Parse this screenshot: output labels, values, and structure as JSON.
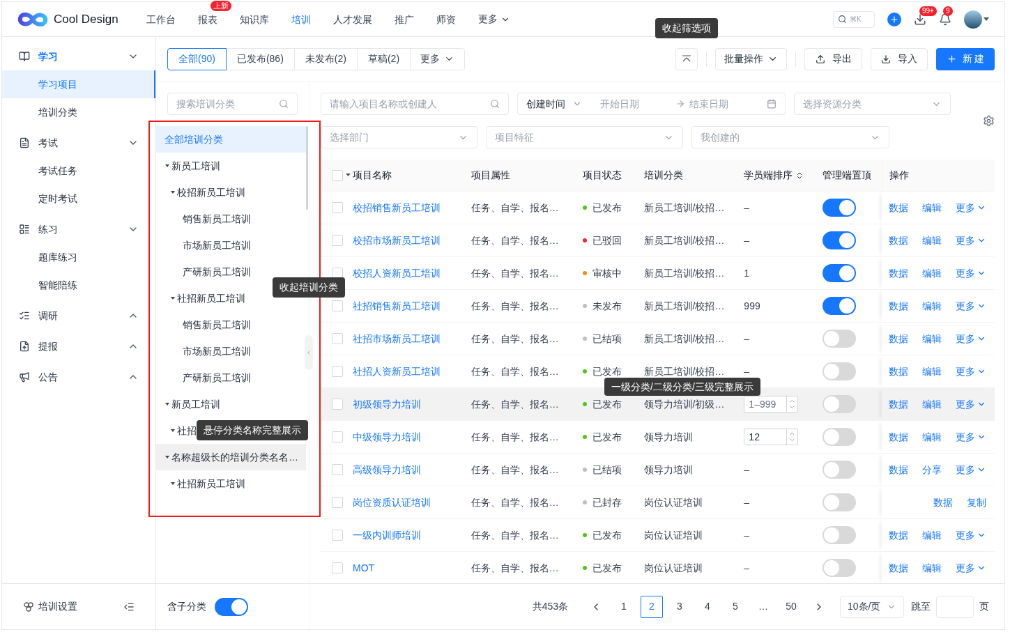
{
  "nav": {
    "logo": "Cool Design",
    "items": [
      {
        "label": "工作台",
        "selected": false
      },
      {
        "label": "报表",
        "selected": false,
        "badge": "上新"
      },
      {
        "label": "知识库",
        "selected": false
      },
      {
        "label": "培训",
        "selected": true
      },
      {
        "label": "人才发展",
        "selected": false
      },
      {
        "label": "推广",
        "selected": false
      },
      {
        "label": "师资",
        "selected": false
      }
    ],
    "more": "更多",
    "search_hint": "⌘K",
    "download_badge": "99+",
    "bell_badge": "9"
  },
  "sidebar": {
    "groups": [
      {
        "label": "学习",
        "kind": "book",
        "expanded": true,
        "selected": true,
        "children": [
          {
            "label": "学习项目",
            "selected": true
          },
          {
            "label": "培训分类",
            "selected": false
          }
        ]
      },
      {
        "label": "考试",
        "kind": "exam",
        "expanded": true,
        "selected": false,
        "children": [
          {
            "label": "考试任务",
            "selected": false
          },
          {
            "label": "定时考试",
            "selected": false
          }
        ]
      },
      {
        "label": "练习",
        "kind": "practice",
        "expanded": true,
        "selected": false,
        "children": [
          {
            "label": "题库练习",
            "selected": false
          },
          {
            "label": "智能陪练",
            "selected": false
          }
        ]
      },
      {
        "label": "调研",
        "kind": "survey",
        "expanded": false,
        "selected": false
      },
      {
        "label": "提报",
        "kind": "report",
        "expanded": false,
        "selected": false
      },
      {
        "label": "公告",
        "kind": "notice",
        "expanded": false,
        "selected": false
      }
    ],
    "footer": "培训设置"
  },
  "toolbar": {
    "tabs": [
      {
        "label": "全部(90)",
        "selected": true
      },
      {
        "label": "已发布(86)",
        "selected": false
      },
      {
        "label": "未发布(2)",
        "selected": false
      },
      {
        "label": "草稿(2)",
        "selected": false
      }
    ],
    "more": "更多",
    "collapse_tooltip": "收起筛选项",
    "batch": "批量操作",
    "export": "导出",
    "import": "导入",
    "create": "新 建"
  },
  "tree": {
    "search_placeholder": "搜索培训分类",
    "collapse_tooltip": "收起培训分类",
    "include_children": {
      "label": "含子分类",
      "on": true
    },
    "items": [
      {
        "label": "全部培训分类",
        "selected": true,
        "hovered": false
      },
      {
        "label": "新员工培训",
        "selected": false,
        "hovered": false,
        "expanded": true,
        "children": [
          {
            "label": "校招新员工培训",
            "selected": false,
            "hovered": false,
            "expanded": true,
            "children": [
              {
                "label": "销售新员工培训",
                "selected": false,
                "hovered": false
              },
              {
                "label": "市场新员工培训",
                "selected": false,
                "hovered": false
              },
              {
                "label": "产研新员工培训",
                "selected": false,
                "hovered": false
              }
            ]
          },
          {
            "label": "社招新员工培训",
            "selected": false,
            "hovered": false,
            "expanded": true,
            "children": [
              {
                "label": "销售新员工培训",
                "selected": false,
                "hovered": false
              },
              {
                "label": "市场新员工培训",
                "selected": false,
                "hovered": false
              },
              {
                "label": "产研新员工培训",
                "selected": false,
                "hovered": false
              }
            ]
          }
        ]
      },
      {
        "label": "新员工培训",
        "selected": false,
        "hovered": false,
        "expanded": true,
        "children": [
          {
            "label": "社招",
            "selected": false,
            "hovered": false,
            "expanded": true,
            "tooltip": "悬停分类名称完整展示"
          }
        ]
      },
      {
        "label": "名称超级长的培训分类名名…",
        "selected": false,
        "hovered": true,
        "expanded": true,
        "children": [
          {
            "label": "社招新员工培训",
            "selected": false,
            "hovered": false,
            "expanded": true
          }
        ]
      }
    ]
  },
  "filters": {
    "search_placeholder": "请输入项目名称或创建人",
    "date_type": "创建时间",
    "start_placeholder": "开始日期",
    "end_placeholder": "结束日期",
    "resource_placeholder": "选择资源分类",
    "department_placeholder": "选择部门",
    "feature_placeholder": "项目特征",
    "creator": "我创建的"
  },
  "table": {
    "header_checked": false,
    "columns": [
      "项目名称",
      "项目属性",
      "项目状态",
      "培训分类",
      "学员端排序",
      "管理端置顶",
      "操作"
    ],
    "rows": [
      {
        "name": "校招销售新员工培训",
        "checked": false,
        "attr": "任务、自学、报名…",
        "status": {
          "label": "已发布",
          "color": "#52c41a"
        },
        "category": "新员工培训/校招…",
        "sort": {
          "kind": "text",
          "value": "–"
        },
        "pinned": true,
        "hovered": false,
        "actions": [
          {
            "label": "数据",
            "kind": "link"
          },
          {
            "label": "编辑",
            "kind": "link"
          },
          {
            "label": "更多",
            "kind": "menu"
          }
        ]
      },
      {
        "name": "校招市场新员工培训",
        "checked": false,
        "attr": "任务、自学、报名…",
        "status": {
          "label": "已驳回",
          "color": "#f5222d"
        },
        "category": "新员工培训/校招…",
        "sort": {
          "kind": "text",
          "value": "–"
        },
        "pinned": true,
        "hovered": false,
        "actions": [
          {
            "label": "数据",
            "kind": "link"
          },
          {
            "label": "编辑",
            "kind": "link"
          },
          {
            "label": "更多",
            "kind": "menu"
          }
        ]
      },
      {
        "name": "校招人资新员工培训",
        "checked": false,
        "attr": "任务、自学、报名…",
        "status": {
          "label": "审核中",
          "color": "#fa8c16"
        },
        "category": "新员工培训/校招…",
        "sort": {
          "kind": "text",
          "value": "1"
        },
        "pinned": true,
        "hovered": false,
        "actions": [
          {
            "label": "数据",
            "kind": "link"
          },
          {
            "label": "编辑",
            "kind": "link"
          },
          {
            "label": "更多",
            "kind": "menu"
          }
        ]
      },
      {
        "name": "社招销售新员工培训",
        "checked": false,
        "attr": "任务、自学、报名…",
        "status": {
          "label": "未发布",
          "color": "#bfbfbf"
        },
        "category": "新员工培训/校招…",
        "sort": {
          "kind": "text",
          "value": "999"
        },
        "pinned": true,
        "hovered": false,
        "actions": [
          {
            "label": "数据",
            "kind": "link"
          },
          {
            "label": "编辑",
            "kind": "link"
          },
          {
            "label": "更多",
            "kind": "menu"
          }
        ]
      },
      {
        "name": "社招市场新员工培训",
        "checked": false,
        "attr": "任务、自学、报名…",
        "status": {
          "label": "已结项",
          "color": "#bfbfbf"
        },
        "category": "新员工培训/校招…",
        "sort": {
          "kind": "text",
          "value": "–"
        },
        "pinned": false,
        "hovered": false,
        "actions": [
          {
            "label": "数据",
            "kind": "link"
          },
          {
            "label": "编辑",
            "kind": "link"
          },
          {
            "label": "更多",
            "kind": "menu"
          }
        ]
      },
      {
        "name": "社招人资新员工培训",
        "checked": false,
        "attr": "任务、自学、报名…",
        "status": {
          "label": "已发布",
          "color": "#52c41a"
        },
        "category": "新员工培训/校招…",
        "sort": {
          "kind": "text",
          "value": "–"
        },
        "pinned": false,
        "hovered": false,
        "actions": [
          {
            "label": "数据",
            "kind": "link"
          },
          {
            "label": "编辑",
            "kind": "link"
          },
          {
            "label": "更多",
            "kind": "menu"
          }
        ]
      },
      {
        "name": "初级领导力培训",
        "checked": false,
        "attr": "任务、自学、报名…",
        "status": {
          "label": "已发布",
          "color": "#52c41a"
        },
        "category": "领导力培训/初级…",
        "tooltip": "一级分类/二级分类/三级完整展示",
        "sort": {
          "kind": "input",
          "placeholder": "1–999"
        },
        "pinned": false,
        "hovered": true,
        "actions": [
          {
            "label": "数据",
            "kind": "link"
          },
          {
            "label": "编辑",
            "kind": "link"
          },
          {
            "label": "更多",
            "kind": "menu"
          }
        ]
      },
      {
        "name": "中级领导力培训",
        "checked": false,
        "attr": "任务、自学、报名…",
        "status": {
          "label": "已发布",
          "color": "#52c41a"
        },
        "category": "领导力培训",
        "sort": {
          "kind": "input",
          "value": "12"
        },
        "pinned": false,
        "hovered": false,
        "actions": [
          {
            "label": "数据",
            "kind": "link"
          },
          {
            "label": "编辑",
            "kind": "link"
          },
          {
            "label": "更多",
            "kind": "menu"
          }
        ]
      },
      {
        "name": "高级领导力培训",
        "checked": false,
        "attr": "任务、自学、报名…",
        "status": {
          "label": "已结项",
          "color": "#bfbfbf"
        },
        "category": "领导力培训",
        "sort": {
          "kind": "text",
          "value": "–"
        },
        "pinned": false,
        "hovered": false,
        "actions": [
          {
            "label": "数据",
            "kind": "link"
          },
          {
            "label": "分享",
            "kind": "link"
          },
          {
            "label": "更多",
            "kind": "menu"
          }
        ]
      },
      {
        "name": "岗位资质认证培训",
        "checked": false,
        "attr": "任务、自学、报名…",
        "status": {
          "label": "已封存",
          "color": "#bfbfbf"
        },
        "category": "岗位认证培训",
        "sort": {
          "kind": "text",
          "value": "–"
        },
        "pinned": false,
        "hovered": false,
        "actions": [
          {
            "label": "数据",
            "kind": "link"
          },
          {
            "label": "复制",
            "kind": "link"
          }
        ]
      },
      {
        "name": "一级内训师培训",
        "checked": false,
        "attr": "任务、自学、报名…",
        "status": {
          "label": "已发布",
          "color": "#52c41a"
        },
        "category": "岗位认证培训",
        "sort": {
          "kind": "text",
          "value": "–"
        },
        "pinned": false,
        "hovered": false,
        "actions": [
          {
            "label": "数据",
            "kind": "link"
          },
          {
            "label": "编辑",
            "kind": "link"
          },
          {
            "label": "更多",
            "kind": "menu"
          }
        ]
      },
      {
        "name": "MOT",
        "checked": false,
        "attr": "任务、自学、报名…",
        "status": {
          "label": "已发布",
          "color": "#52c41a"
        },
        "category": "岗位认证培训",
        "sort": {
          "kind": "text",
          "value": "–"
        },
        "pinned": false,
        "hovered": false,
        "actions": [
          {
            "label": "数据",
            "kind": "link"
          },
          {
            "label": "编辑",
            "kind": "link"
          },
          {
            "label": "更多",
            "kind": "menu"
          }
        ]
      }
    ]
  },
  "pagination": {
    "total": "共453条",
    "pages": [
      {
        "label": "1",
        "selected": false
      },
      {
        "label": "2",
        "selected": true
      },
      {
        "label": "3",
        "selected": false
      },
      {
        "label": "4",
        "selected": false
      },
      {
        "label": "5",
        "selected": false
      },
      {
        "label": "…",
        "selected": false
      },
      {
        "label": "50",
        "selected": false
      }
    ],
    "page_size": "10条/页",
    "jump_label": "跳至",
    "jump_suffix": "页"
  }
}
